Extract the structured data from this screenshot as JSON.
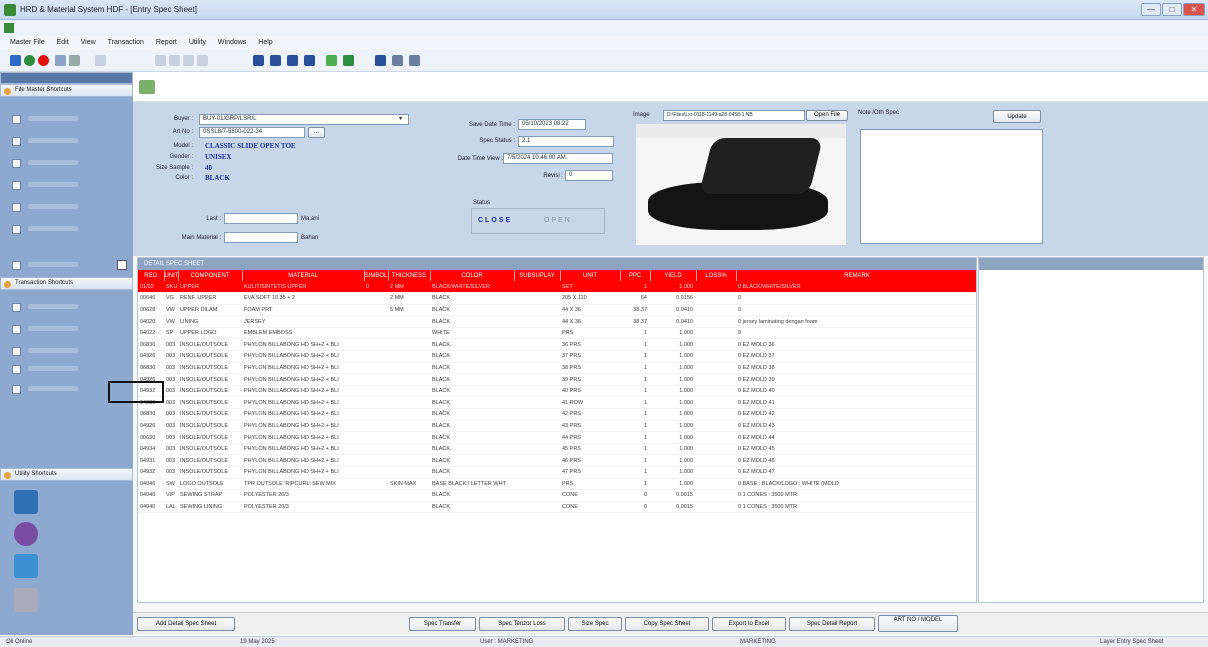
{
  "window": {
    "title": "HRD & Material System HDF - [Entry Spec Sheet]",
    "min": "—",
    "max": "□",
    "close": "✕"
  },
  "menu": [
    "Master File",
    "Edit",
    "View",
    "Transaction",
    "Report",
    "Utility",
    "Windows",
    "Help"
  ],
  "sidebar": {
    "master_header": "File Master Shortcuts",
    "transaction_header": "Transaction Shortcuts",
    "utility_header": "Utility Shortcuts"
  },
  "form": {
    "buyer_label": "Buyer :",
    "buyer_value": "BUY-01/GRP/LSR/L",
    "art_no_label": "Art No :",
    "art_no_value": "0SSL8/7-5800-022-34",
    "browse": "...",
    "model_label": "Model :",
    "model_value": "CLASSIC SLIDE OPEN TOE",
    "gender_label": "Gender :",
    "gender_value": "UNISEX",
    "size_sample_label": "Size Sample :",
    "size_sample_value": "40",
    "color_label": "Color :",
    "color_value": "BLACK",
    "last_label": "Last :",
    "last_unit": "Ma.ani",
    "main_material_label": "Main Material :",
    "main_material_unit": "Bahan",
    "save_date_label": "Save Date Time :",
    "save_date_value": "05/10/2023 08:22",
    "spec_status_label": "Spec Status :",
    "spec_status_value": "2.1",
    "date_time_view_label": "Date Time View :",
    "date_time_view_value": "7/5/2024 10:46:00 AM",
    "revisi_label": "Revisi :",
    "revisi_value": "0",
    "status_label": "Status",
    "status_close": "CLOSE",
    "status_open": "OPEN",
    "image_label": "Image",
    "image_path": "D:\\Files\\Lsr-0118-1149-a28-0458-1 NB",
    "open_file": "Open File",
    "note_label": "Note /Oth Spec",
    "update": "Update"
  },
  "grid": {
    "caption": "DETAIL SPEC SHEET",
    "columns": [
      "REG",
      "UNIT",
      "COMPONENT",
      "MATERIAL",
      "SIMBOL",
      "THICKNESS",
      "COLOR",
      "SUBSUPLAY",
      "UNIT",
      "PPC",
      "YIELD",
      "LOSS%",
      "REMARK"
    ],
    "rows": [
      [
        "01/02",
        "SKU",
        "UPPER",
        "KULIT/SINTETIS UPPER",
        "0",
        "2 MM",
        "BLACK/WHITE/SILVER",
        "",
        "SET",
        "1",
        "1.000",
        "",
        "0 BLACK/WHITE/SILVER"
      ],
      [
        "00646",
        "VG",
        "RENF. UPPER",
        "EVA SOFT 10.35 + 2",
        "",
        "2 MM",
        "BLACK",
        "",
        "205 X 110",
        "64",
        "0.0156",
        "",
        "0"
      ],
      [
        "00628",
        "VW",
        "UPPER DILAM",
        "FOAM PRT",
        "",
        "5 MM",
        "BLACK",
        "",
        "44 X 36",
        "38.37",
        "0.0410",
        "",
        "0"
      ],
      [
        "04020",
        "VW",
        "LINING",
        "JERSEY",
        "",
        "",
        "BLACK",
        "",
        "44 X 36",
        "38.37",
        "0.0410",
        "",
        "0 jersey laminating dengan foam"
      ],
      [
        "04022",
        "SP",
        "UPPER LOGO",
        "EMBLEM EMBOSS",
        "",
        "",
        "WHITE",
        "",
        "PRS",
        "1",
        "1.000",
        "",
        "0"
      ],
      [
        "06830",
        "003",
        "INSOLE/OUTSOLE",
        "PHYLON BILLABONG HD SH+2 + BLI",
        "",
        "",
        "BLACK",
        "",
        "36 PRS",
        "1",
        "1.000",
        "",
        "0 EZ MOLD 36"
      ],
      [
        "04926",
        "003",
        "INSOLE/OUTSOLE",
        "PHYLON BILLABONG HD SH+2 + BLI",
        "",
        "",
        "BLACK",
        "",
        "37 PRS",
        "1",
        "1.000",
        "",
        "0 EZ MOLD 37"
      ],
      [
        "06830",
        "003",
        "INSOLE/OUTSOLE",
        "PHYLON BILLABONG HD SH+2 + BLI",
        "",
        "",
        "BLACK",
        "",
        "38 PRS",
        "1",
        "1.000",
        "",
        "0 EZ MOLD 38"
      ],
      [
        "04926",
        "003",
        "INSOLE/OUTSOLE",
        "PHYLON BILLABONG HD SH+2 + BLI",
        "",
        "",
        "BLACK",
        "",
        "39 PRS",
        "1",
        "1.000",
        "",
        "0 EZ MOLD 39"
      ],
      [
        "04932",
        "003",
        "INSOLE/OUTSOLE",
        "PHYLON BILLABONG HD SH+2 + BLI",
        "",
        "",
        "BLACK",
        "",
        "40 PRS",
        "1",
        "1.000",
        "",
        "0 EZ MOLD 40"
      ],
      [
        "04930",
        "003",
        "INSOLE/OUTSOLE",
        "PHYLON BILLABONG HD SH+2 + BLI",
        "",
        "",
        "BLACK",
        "",
        "41 ROW",
        "1",
        "1.000",
        "",
        "0 EZ MOLD 41"
      ],
      [
        "06830",
        "003",
        "INSOLE/OUTSOLE",
        "PHYLON BILLABONG HD SH+2 + BLI",
        "",
        "",
        "BLACK",
        "",
        "42 PRS",
        "1",
        "1.000",
        "",
        "0 EZ MOLD 42"
      ],
      [
        "04926",
        "003",
        "INSOLE/OUTSOLE",
        "PHYLON BILLABONG HD SH+2 + BLI",
        "",
        "",
        "BLACK",
        "",
        "43 PRS",
        "1",
        "1.000",
        "",
        "0 EZ MOLD 43"
      ],
      [
        "00630",
        "003",
        "INSOLE/OUTSOLE",
        "PHYLON BILLABONG HD SH+2 + BLI",
        "",
        "",
        "BLACK",
        "",
        "44 PRS",
        "1",
        "1.000",
        "",
        "0 EZ MOLD 44"
      ],
      [
        "04934",
        "003",
        "INSOLE/OUTSOLE",
        "PHYLON BILLABONG HD SH+2 + BLI",
        "",
        "",
        "BLACK",
        "",
        "45 PRS",
        "1",
        "1.000",
        "",
        "0 EZ MOLD 45"
      ],
      [
        "04931",
        "003",
        "INSOLE/OUTSOLE",
        "PHYLON BILLABONG HD SH+2 + BLI",
        "",
        "",
        "BLACK",
        "",
        "46 PRS",
        "1",
        "1.000",
        "",
        "0 EZ MOLD 46"
      ],
      [
        "04932",
        "003",
        "INSOLE/OUTSOLE",
        "PHYLON BILLABONG HD SH+2 + BLI",
        "",
        "",
        "BLACK",
        "",
        "47 PRS",
        "1",
        "1.000",
        "",
        "0 EZ MOLD 47"
      ],
      [
        "04046",
        "SW",
        "LOGO OUTSOLE",
        "TPR OUTSOLE 'RIPCURL' SEW MIX",
        "",
        "SKIN MAX",
        "BASE BLACK / LETTER WHT",
        "",
        "PRS",
        "1",
        "1.000",
        "",
        "0 BASE : BLACK/LOGO : WHITE (MOLD"
      ],
      [
        "04040",
        "VIP",
        "SEWING STRAP",
        "POLYESTER 20/3",
        "",
        "",
        "BLACK",
        "",
        "CONE",
        "0",
        "0.0015",
        "",
        "0 1 CONES : 3500 MTR"
      ],
      [
        "04040",
        "LAL",
        "SEWING LINING",
        "POLYESTER 20/3",
        "",
        "",
        "BLACK",
        "",
        "CONE",
        "0",
        "0.0015",
        "",
        "0 1 CONES : 3500 MTR"
      ]
    ]
  },
  "buttons": {
    "add_detail": "Add Detail Spec Sheet",
    "spec_transfer": "Spec Transfer",
    "spec_tenzor_loss": "Spec Tenzor Loss",
    "size_spec": "Size Spec",
    "copy_spec": "Copy Spec Sheet",
    "export_excel": "Export to Excel",
    "spec_detail_report": "Spec Detail Report",
    "art_no_model": "ART NO / MODEL"
  },
  "status": {
    "caps": "Oli Online",
    "date": "19 May 2025",
    "user": "User : MARKETING",
    "dept": "MARKETING",
    "form": "Layer Entry Spec Sheet"
  },
  "colors": {
    "accent_red": "#ff0000",
    "sidebar": "#8ea9cf",
    "form_bg": "#c8d6ea"
  },
  "icons": [
    "app-icon",
    "minimize-icon",
    "maximize-icon",
    "close-icon",
    "folder-icon",
    "slide-sandal-image",
    "calendar-icon"
  ]
}
